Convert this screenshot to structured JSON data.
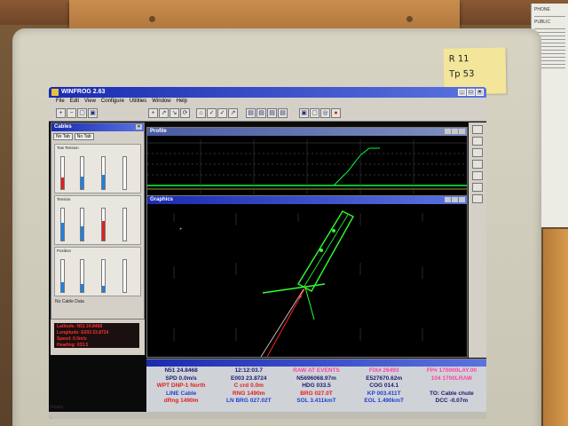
{
  "note": {
    "line1": "R  11",
    "line2": "Tp  53"
  },
  "phone_card": {
    "title": "PHONE",
    "subtitle": "PUBLIC"
  },
  "app": {
    "title": "WINFROG 2.63",
    "menu": [
      "File",
      "Edit",
      "View",
      "Configure",
      "Utilities",
      "Window",
      "Help"
    ]
  },
  "cables": {
    "title": "Cables",
    "close": "×",
    "tabs": [
      "No Tab",
      "No Tab"
    ],
    "groups": [
      {
        "title": "Tow Tension"
      },
      {
        "title": "Tension"
      },
      {
        "title": "Position"
      }
    ],
    "status": "No Cable Data"
  },
  "info": {
    "line1": "Latitude: N51 24.8468",
    "line2": "Longitude: E003 23.8724",
    "line3": "Speed: 0.0m/s",
    "line4": "Heading: 033.5"
  },
  "profile": {
    "title": "Profile"
  },
  "graphics": {
    "title": "Graphics"
  },
  "data_grid": {
    "rows": [
      [
        {
          "text": "N51 24.8468",
          "color": "#1a1a70"
        },
        {
          "text": "12:12:03.7",
          "color": "#1a1a70"
        },
        {
          "text": "RAW AT EVENTS",
          "color": "#ff40a0"
        },
        {
          "text": "FIX# 26493",
          "color": "#ff40a0"
        },
        {
          "text": "FP# 170000LAY.00",
          "color": "#ff40a0"
        }
      ],
      [
        {
          "text": "SPD 0.0m/s",
          "color": "#1a1a70"
        },
        {
          "text": "E003 23.8724",
          "color": "#1a1a70"
        },
        {
          "text": "N5696068.97m",
          "color": "#1a1a70"
        },
        {
          "text": "E527670.62m",
          "color": "#1a1a70"
        },
        {
          "text": "104 1700LRAW",
          "color": "#ff40a0"
        }
      ],
      [
        {
          "text": "WPT DNP-1 North",
          "color": "#e02020"
        },
        {
          "text": "C crd 0.0m",
          "color": "#e02020"
        },
        {
          "text": "HDG 033.5",
          "color": "#1a1a70"
        },
        {
          "text": "COG 014.1",
          "color": "#1a1a70"
        },
        {
          "text": "",
          "color": "#1a1a70"
        }
      ],
      [
        {
          "text": "LINE Cable",
          "color": "#2040d0"
        },
        {
          "text": "RNG 1490m",
          "color": "#e02020"
        },
        {
          "text": "BRG 027.0T",
          "color": "#e02020"
        },
        {
          "text": "KP 003.411T",
          "color": "#2040d0"
        },
        {
          "text": "TO: Cable chute",
          "color": "#1a1a70"
        }
      ],
      [
        {
          "text": "dRng 1490m",
          "color": "#e02020"
        },
        {
          "text": "LN BRG 027.02T",
          "color": "#2040d0"
        },
        {
          "text": "SOL 3.411kmT",
          "color": "#2040d0"
        },
        {
          "text": "EOL 1.490kmT",
          "color": "#2040d0"
        },
        {
          "text": "DCC -0.07m",
          "color": "#1a1a70"
        }
      ]
    ]
  },
  "status_bar": "Ready"
}
